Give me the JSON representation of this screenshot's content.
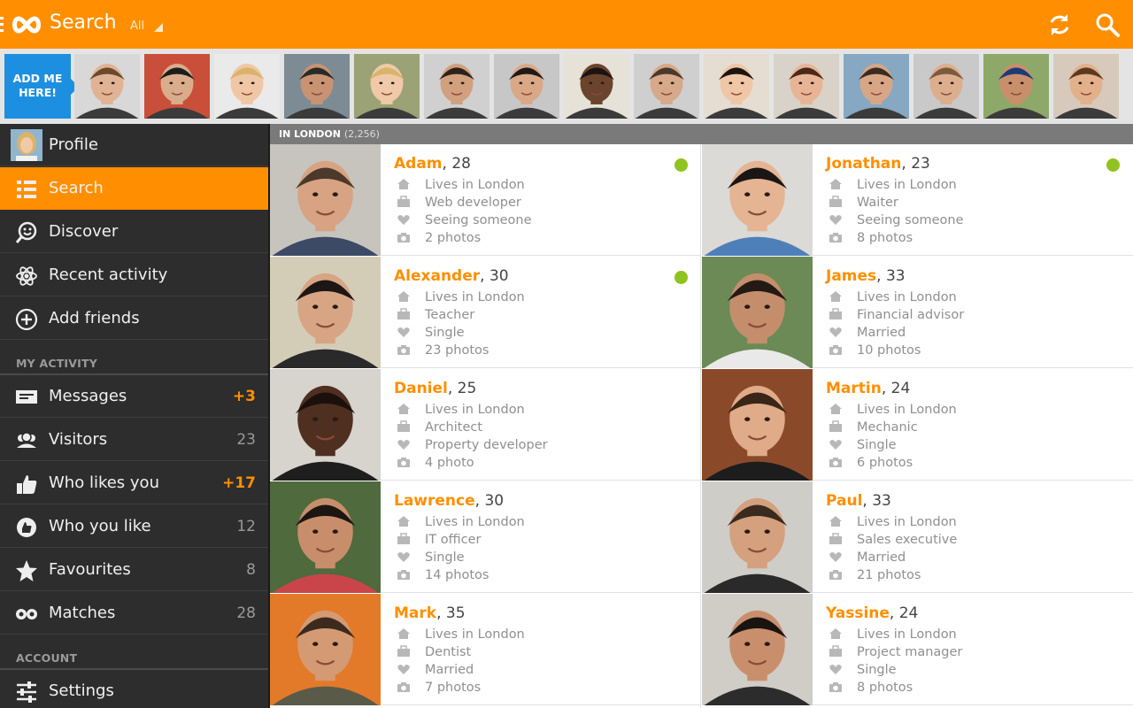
{
  "header": {
    "title": "Search",
    "filter_label": "All",
    "accent": "#ff8f00"
  },
  "strip": {
    "add_me_line1": "ADD ME",
    "add_me_line2": "HERE!",
    "thumbnails": [
      {
        "skin": "#e0b394",
        "hair": "#6b4a2c",
        "bg": "#d8d8d8"
      },
      {
        "skin": "#d9ad8c",
        "hair": "#1d1d1d",
        "bg": "#c94f3a"
      },
      {
        "skin": "#f0c7a6",
        "hair": "#d9b36a",
        "bg": "#eaeaea"
      },
      {
        "skin": "#c99373",
        "hair": "#2a2a2a",
        "bg": "#7d8b94"
      },
      {
        "skin": "#f0c9a8",
        "hair": "#d8b569",
        "bg": "#9aa276"
      },
      {
        "skin": "#d1a07e",
        "hair": "#2c2218",
        "bg": "#d0d0d0"
      },
      {
        "skin": "#d8a887",
        "hair": "#1f1a16",
        "bg": "#c7c7c7"
      },
      {
        "skin": "#6b442d",
        "hair": "#1b1411",
        "bg": "#e7e2d8"
      },
      {
        "skin": "#d6a98a",
        "hair": "#4a3a2c",
        "bg": "#cfcfcf"
      },
      {
        "skin": "#efc6a6",
        "hair": "#1b1510",
        "bg": "#e5ddd2"
      },
      {
        "skin": "#e7b596",
        "hair": "#4a2a17",
        "bg": "#d9d2c8"
      },
      {
        "skin": "#d7a687",
        "hair": "#3a2c20",
        "bg": "#86a8c2"
      },
      {
        "skin": "#dcae8e",
        "hair": "#7b5a3e",
        "bg": "#c9c9c9"
      },
      {
        "skin": "#c98f6a",
        "hair": "#1c3b78",
        "bg": "#8ea86a"
      },
      {
        "skin": "#e2b08a",
        "hair": "#5a3a22",
        "bg": "#d7cabd"
      }
    ]
  },
  "sidebar": {
    "profile_label": "Profile",
    "items_top": [
      {
        "label": "Search",
        "icon": "list-icon"
      },
      {
        "label": "Discover",
        "icon": "discover-icon"
      },
      {
        "label": "Recent activity",
        "icon": "atom-icon"
      },
      {
        "label": "Add friends",
        "icon": "add-circle-icon"
      }
    ],
    "section_activity": "MY ACTIVITY",
    "activity": [
      {
        "label": "Messages",
        "count": "+3",
        "hot": true,
        "icon": "messages-icon"
      },
      {
        "label": "Visitors",
        "count": "23",
        "hot": false,
        "icon": "visitors-icon"
      },
      {
        "label": "Who likes you",
        "count": "+17",
        "hot": true,
        "icon": "thumbs-up-icon"
      },
      {
        "label": "Who you like",
        "count": "12",
        "hot": false,
        "icon": "liked-icon"
      },
      {
        "label": "Favourites",
        "count": "8",
        "hot": false,
        "icon": "star-icon"
      },
      {
        "label": "Matches",
        "count": "28",
        "hot": false,
        "icon": "matches-icon"
      }
    ],
    "section_account": "ACCOUNT",
    "settings_label": "Settings"
  },
  "results": {
    "location_label": "IN LONDON",
    "count_label": "(2,256)",
    "online_color": "#8fc31f",
    "people": [
      {
        "name": "Adam",
        "age": ", 28",
        "lives": "Lives in London",
        "job": "Web developer",
        "status": "Seeing someone",
        "photos": "2 photos",
        "online": true,
        "skin": "#d7a382",
        "hair": "#4b3a2b",
        "bg": "#c7c4be",
        "shirt": "#3c4a66"
      },
      {
        "name": "Jonathan",
        "age": ", 23",
        "lives": "Lives in London",
        "job": "Waiter",
        "status": "Seeing someone",
        "photos": "8 photos",
        "online": true,
        "skin": "#e4b493",
        "hair": "#1a1614",
        "bg": "#dcdad6",
        "shirt": "#4f7fb9"
      },
      {
        "name": "Alexander",
        "age": ", 30",
        "lives": "Lives in London",
        "job": "Teacher",
        "status": "Single",
        "photos": "23 photos",
        "online": true,
        "skin": "#d8a584",
        "hair": "#1c1714",
        "bg": "#d3cdb8",
        "shirt": "#2a2a2a"
      },
      {
        "name": "James",
        "age": ", 33",
        "lives": "Lives in London",
        "job": "Financial advisor",
        "status": "Married",
        "photos": "10 photos",
        "online": false,
        "skin": "#c48e6d",
        "hair": "#241a14",
        "bg": "#6b8a56",
        "shirt": "#e9e9e9"
      },
      {
        "name": "Daniel",
        "age": ", 25",
        "lives": "Lives in London",
        "job": "Architect",
        "status": "Property developer",
        "photos": "4 photo",
        "online": false,
        "skin": "#4f2f1f",
        "hair": "#1b110c",
        "bg": "#d7d3cd",
        "shirt": "#1e1e1e"
      },
      {
        "name": "Martin",
        "age": ", 24",
        "lives": "Lives in London",
        "job": "Mechanic",
        "status": "Single",
        "photos": "6 photos",
        "online": false,
        "skin": "#e0ab88",
        "hair": "#3a2617",
        "bg": "#8a4a2a",
        "shirt": "#1d1d1d"
      },
      {
        "name": "Lawrence",
        "age": ", 30",
        "lives": "Lives in London",
        "job": "IT  officer",
        "status": "Single",
        "photos": "14 photos",
        "online": false,
        "skin": "#c88e6b",
        "hair": "#1c1612",
        "bg": "#4f6a3c",
        "shirt": "#c9454a"
      },
      {
        "name": "Paul",
        "age": ", 33",
        "lives": "Lives in London",
        "job": "Sales executive",
        "status": "Married",
        "photos": "21 photos",
        "online": false,
        "skin": "#d4a07e",
        "hair": "#3b2a1e",
        "bg": "#cfcdc8",
        "shirt": "#2a2a2a"
      },
      {
        "name": "Mark",
        "age": ", 35",
        "lives": "Lives in London",
        "job": "Dentist",
        "status": "Married",
        "photos": "7 photos",
        "online": false,
        "skin": "#d39a74",
        "hair": "#3d2a1e",
        "bg": "#e27a2a",
        "shirt": "#5a5a48"
      },
      {
        "name": "Yassine",
        "age": ", 24",
        "lives": "Lives in London",
        "job": "Project manager",
        "status": "Single",
        "photos": "8 photos",
        "online": false,
        "skin": "#c98f6c",
        "hair": "#1a1411",
        "bg": "#d0ccc6",
        "shirt": "#2c2c2c"
      }
    ]
  }
}
